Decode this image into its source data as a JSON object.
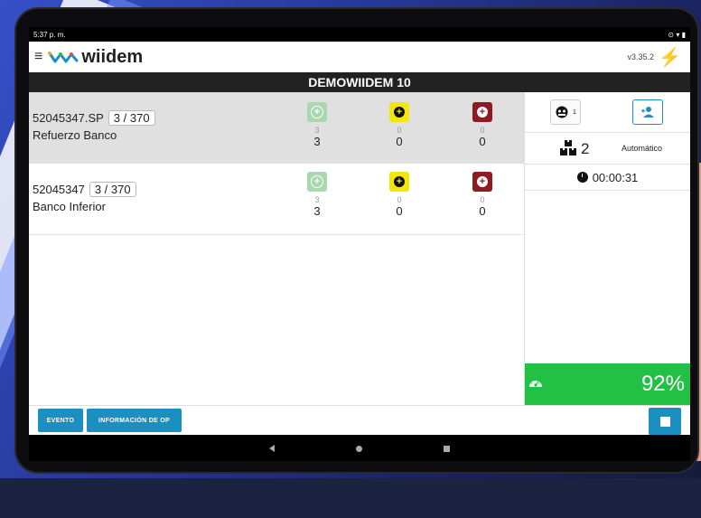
{
  "status_bar": {
    "time": "5:37 p. m."
  },
  "app": {
    "brand": "wiidem",
    "version": "v3.35.2",
    "title": "DEMOWIIDEM 10"
  },
  "jobs": [
    {
      "code": "52045347.SP",
      "qty": "3 / 370",
      "name": "Refuerzo Banco",
      "counters": [
        {
          "small": "3",
          "big": "3"
        },
        {
          "small": "0",
          "big": "0"
        },
        {
          "small": "0",
          "big": "0"
        }
      ]
    },
    {
      "code": "52045347",
      "qty": "3 / 370",
      "name": "Banco Inferior",
      "counters": [
        {
          "small": "3",
          "big": "3"
        },
        {
          "small": "0",
          "big": "0"
        },
        {
          "small": "0",
          "big": "0"
        }
      ]
    }
  ],
  "side": {
    "operators_count": "1",
    "molds": "2",
    "mode": "Automático",
    "timer": "00:00:31",
    "oee": "92%"
  },
  "footer": {
    "evento": "EVENTO",
    "informacion": "INFORMACIÓN DE OP"
  },
  "colors": {
    "accent": "#1b8fc0",
    "ok": "#22c145",
    "warn": "#f3e70a",
    "reject": "#8e1a22"
  }
}
